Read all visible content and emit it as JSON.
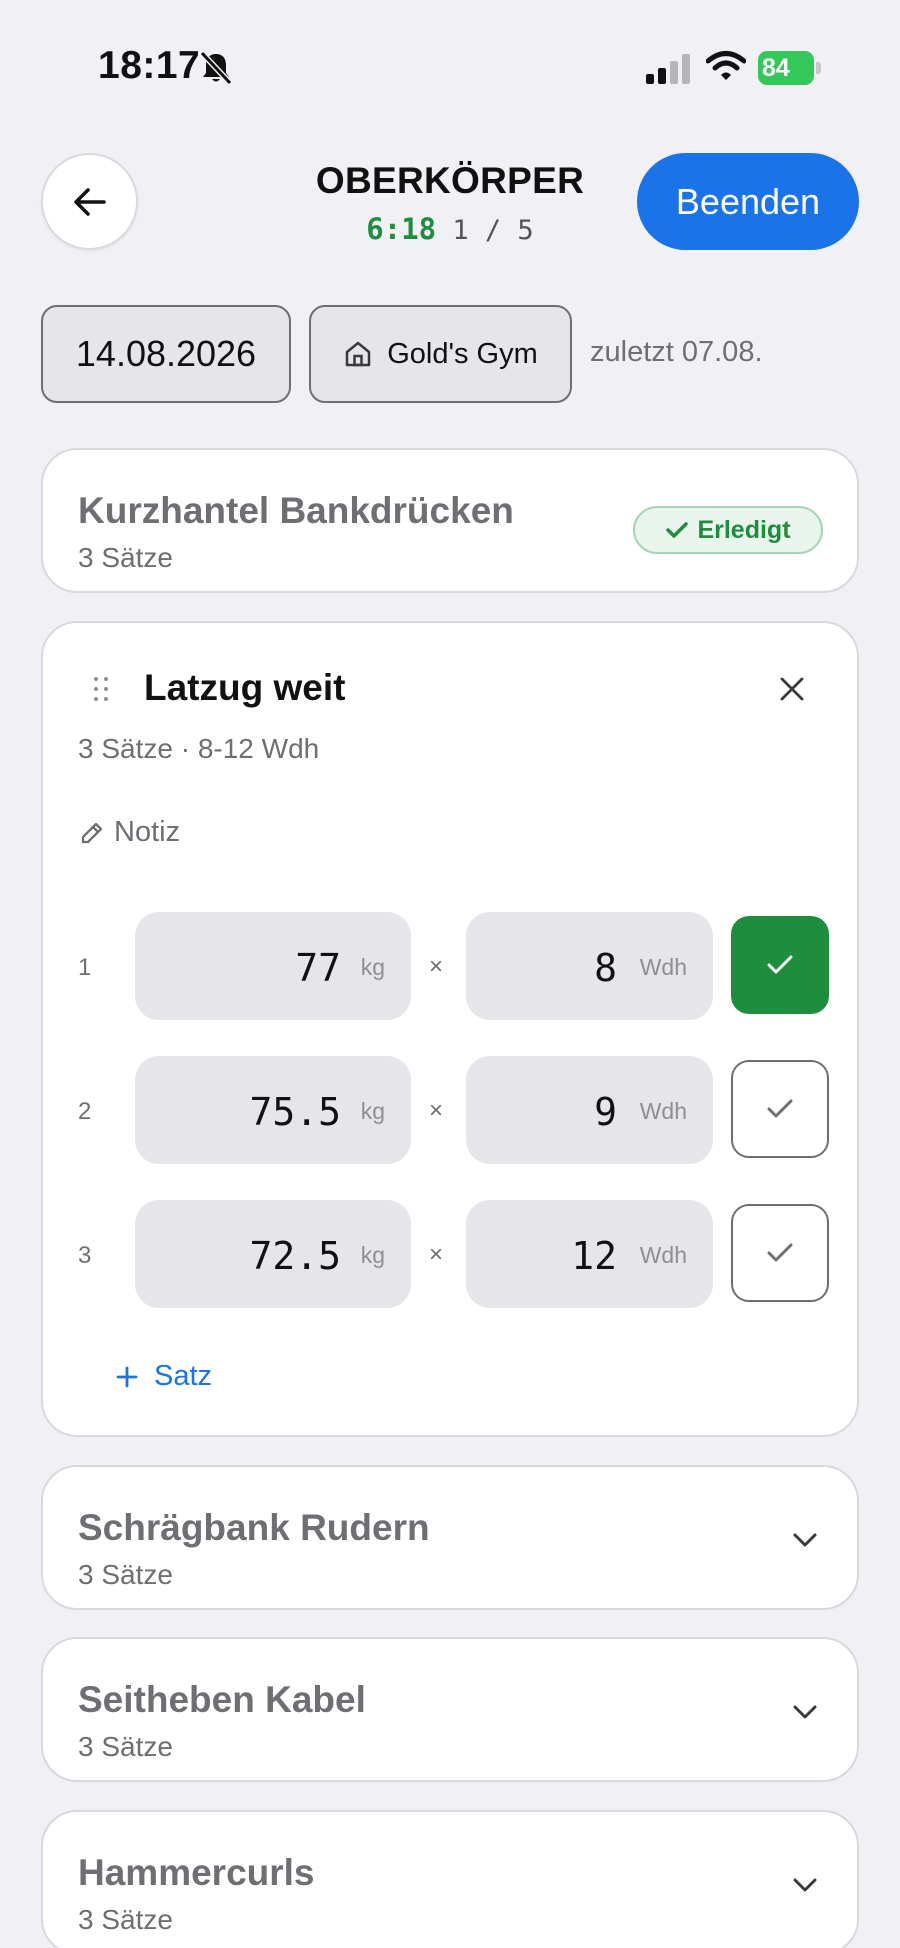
{
  "status_bar": {
    "time": "18:17",
    "battery": "84",
    "icons": [
      "bell-muted-icon",
      "signal-icon",
      "wifi-icon",
      "battery-charging-icon"
    ]
  },
  "header": {
    "back_icon": "arrow-left-icon",
    "title": "OBERKÖRPER",
    "timer": "6:18",
    "progress": "1 / 5",
    "finish_label": "Beenden"
  },
  "session": {
    "date": "14.08.2026",
    "gym": "Gold's Gym",
    "gym_icon": "home-icon",
    "last": "zuletzt 07.08."
  },
  "exercises": [
    {
      "name": "Kurzhantel Bankdrücken",
      "sets": "3 Sätze",
      "status": "Erledigt"
    },
    {
      "name": "Latzug weit",
      "meta": "3 Sätze · 8-12 Wdh",
      "note_label": "Notiz",
      "weight_unit": "kg",
      "reps_unit": "Wdh",
      "times": "×",
      "set_rows": [
        {
          "num": "1",
          "weight": "77",
          "reps": "8",
          "done": true
        },
        {
          "num": "2",
          "weight": "75.5",
          "reps": "9",
          "done": false
        },
        {
          "num": "3",
          "weight": "72.5",
          "reps": "12",
          "done": false
        }
      ],
      "add_set_label": "Satz"
    },
    {
      "name": "Schrägbank Rudern",
      "sets": "3 Sätze"
    },
    {
      "name": "Seitheben Kabel",
      "sets": "3 Sätze"
    },
    {
      "name": "Hammercurls",
      "sets": "3 Sätze"
    }
  ],
  "colors": {
    "accent": "#1a73e8",
    "success": "#1e8e3e",
    "background": "#f0f0f5",
    "field": "#e5e5ea"
  }
}
